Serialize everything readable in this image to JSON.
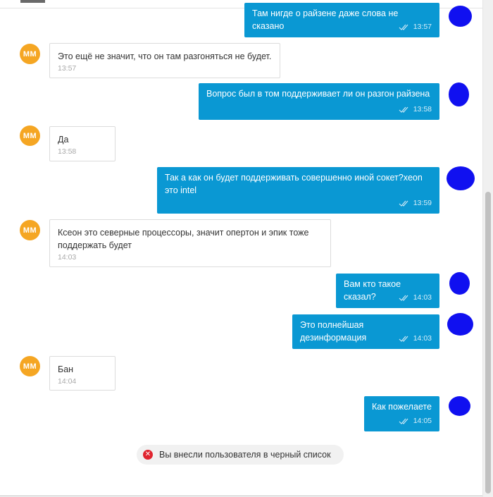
{
  "messages": [
    {
      "type": "out",
      "text": "Там нигде о райзене даже слова не сказано",
      "time": "13:57"
    },
    {
      "type": "in",
      "avatar": "MM",
      "text": "Это ещё не значит, что он там разгоняться не будет.",
      "time": "13:57"
    },
    {
      "type": "out",
      "text": "Вопрос был в том поддерживает ли он разгон райзена",
      "time": "13:58"
    },
    {
      "type": "in",
      "avatar": "MM",
      "text": "Да",
      "time": "13:58"
    },
    {
      "type": "out",
      "text": "Так а как он будет поддерживать совершенно иной сокет?xeon это intel",
      "time": "13:59"
    },
    {
      "type": "in",
      "avatar": "MM",
      "text": "Ксеон это северные процессоры, значит опертон и эпик тоже поддержать будет",
      "time": "14:03"
    },
    {
      "type": "out",
      "text": "Вам кто такое сказал?",
      "time": "14:03"
    },
    {
      "type": "out",
      "text": "Это полнейшая дезинформация",
      "time": "14:03"
    },
    {
      "type": "in",
      "avatar": "MM",
      "text": "Бан",
      "time": "14:04"
    },
    {
      "type": "out",
      "text": "Как пожелаете",
      "time": "14:05"
    }
  ],
  "notice": {
    "text": "Вы внесли пользователя в черный список",
    "icon": "close-circle-icon"
  },
  "colors": {
    "outgoing": "#0a98d3",
    "avatar": "#f5a623",
    "notice_icon": "#e0242f",
    "redaction": "#1010f0"
  }
}
